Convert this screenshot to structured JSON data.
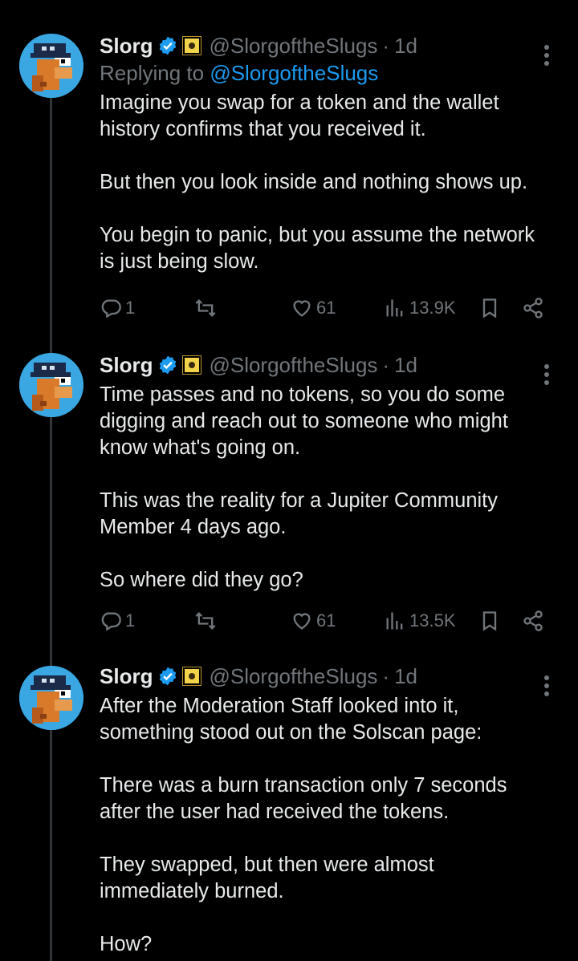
{
  "tweets": [
    {
      "name": "Slorg",
      "handle": "@SlorgoftheSlugs",
      "time": "1d",
      "reply_prefix": "Replying to ",
      "reply_to": "@SlorgoftheSlugs",
      "text": "Imagine you swap for a token and the wallet\nhistory confirms that you received it.\n\nBut then you look inside and nothing shows up.\n\nYou begin to panic, but you assume the network\nis just being slow.",
      "replies": "1",
      "retweets": "",
      "likes": "61",
      "views": "13.9K"
    },
    {
      "name": "Slorg",
      "handle": "@SlorgoftheSlugs",
      "time": "1d",
      "text": "Time passes and no tokens, so you do some\ndigging and reach out to someone who might\nknow what's going on.\n\nThis was the reality for a Jupiter Community\nMember 4 days ago.\n\nSo where did they go?",
      "replies": "1",
      "retweets": "",
      "likes": "61",
      "views": "13.5K"
    },
    {
      "name": "Slorg",
      "handle": "@SlorgoftheSlugs",
      "time": "1d",
      "text": "After the Moderation Staff looked into it,\nsomething stood out on the Solscan page:\n\nThere was a burn transaction only 7 seconds\nafter the user had received the tokens.\n\nThey swapped, but then were almost\nimmediately burned.\n\nHow?"
    }
  ],
  "separator": "·",
  "icons": {
    "verified": "verified-badge-icon",
    "affiliate": "affiliate-badge-icon",
    "more": "more-icon",
    "reply": "reply-icon",
    "retweet": "retweet-icon",
    "like": "heart-icon",
    "views": "views-icon",
    "bookmark": "bookmark-icon",
    "share": "share-icon"
  },
  "colors": {
    "background": "#000000",
    "text": "#e7e9ea",
    "muted": "#71767b",
    "link": "#1d9bf0"
  }
}
